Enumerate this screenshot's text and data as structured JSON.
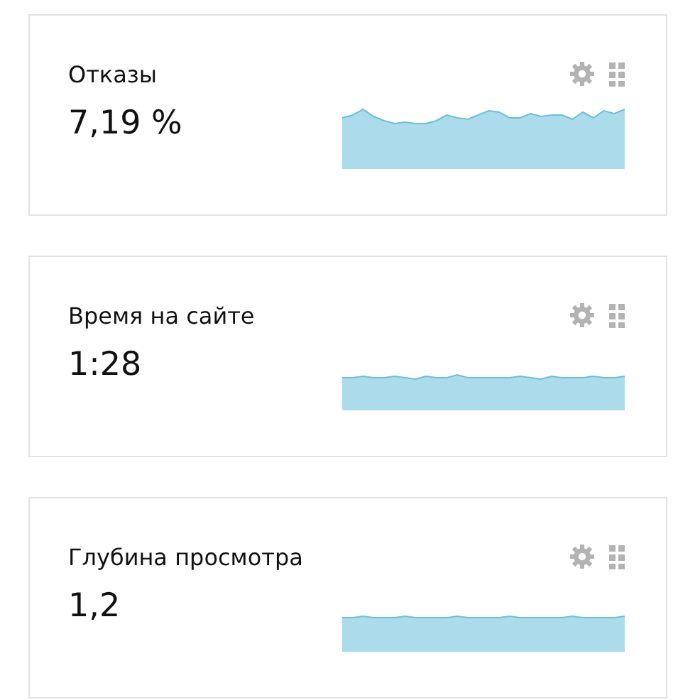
{
  "widgets": [
    {
      "title": "Отказы",
      "value": "7,19 %"
    },
    {
      "title": "Время на сайте",
      "value": "1:28"
    },
    {
      "title": "Глубина просмотра",
      "value": "1,2"
    }
  ]
}
